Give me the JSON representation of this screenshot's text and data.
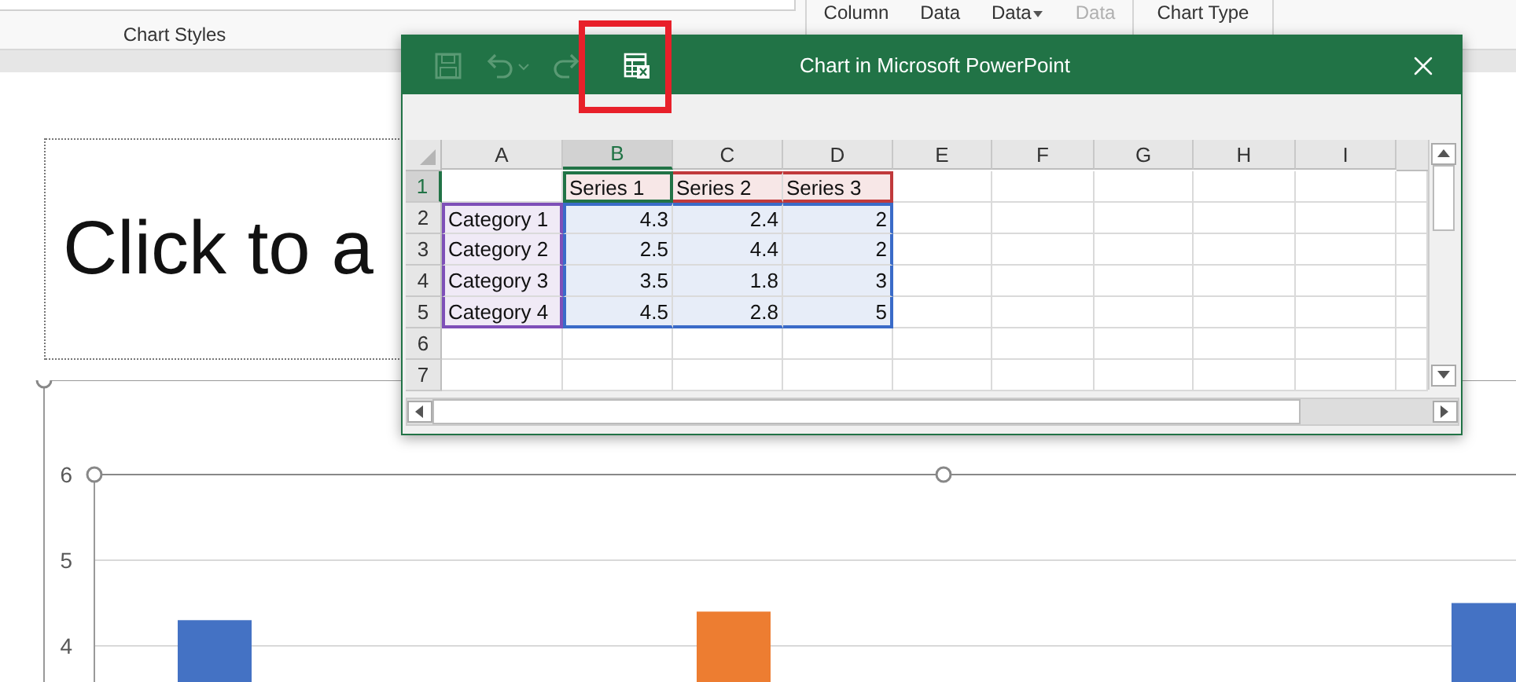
{
  "ribbon": {
    "groups": [
      {
        "label": "Chart Styles"
      }
    ],
    "buttons": [
      {
        "label": "Column",
        "disabled": false
      },
      {
        "label": "Data",
        "disabled": false
      },
      {
        "label": "Data",
        "disabled": false,
        "dropdown": true
      },
      {
        "label": "Data",
        "disabled": true
      },
      {
        "label": "Chart Type",
        "disabled": false
      }
    ]
  },
  "slide": {
    "title_placeholder": "Click to a"
  },
  "chart": {
    "axis_labels": [
      "6",
      "5",
      "4"
    ]
  },
  "dialog": {
    "title": "Chart in Microsoft PowerPoint",
    "columns": [
      {
        "label": "A",
        "selected": false
      },
      {
        "label": "B",
        "selected": true
      },
      {
        "label": "C",
        "selected": false
      },
      {
        "label": "D",
        "selected": false
      },
      {
        "label": "E",
        "selected": false
      },
      {
        "label": "F",
        "selected": false
      },
      {
        "label": "G",
        "selected": false
      },
      {
        "label": "H",
        "selected": false
      },
      {
        "label": "I",
        "selected": false
      }
    ],
    "rows": [
      {
        "label": "1",
        "selected": true,
        "cells": [
          {},
          {
            "text": "Series 1",
            "kind": "header",
            "selected": true
          },
          {
            "text": "Series 2",
            "kind": "header",
            "selected": false
          },
          {
            "text": "Series 3",
            "kind": "header",
            "selected": false
          },
          {},
          {},
          {},
          {},
          {}
        ]
      },
      {
        "label": "2",
        "selected": false,
        "cells": [
          {
            "text": "Category 1",
            "kind": "category"
          },
          {
            "text": "4.3",
            "kind": "value"
          },
          {
            "text": "2.4",
            "kind": "value"
          },
          {
            "text": "2",
            "kind": "value"
          },
          {},
          {},
          {},
          {},
          {}
        ]
      },
      {
        "label": "3",
        "selected": false,
        "cells": [
          {
            "text": "Category 2",
            "kind": "category"
          },
          {
            "text": "2.5",
            "kind": "value"
          },
          {
            "text": "4.4",
            "kind": "value"
          },
          {
            "text": "2",
            "kind": "value"
          },
          {},
          {},
          {},
          {},
          {}
        ]
      },
      {
        "label": "4",
        "selected": false,
        "cells": [
          {
            "text": "Category 3",
            "kind": "category"
          },
          {
            "text": "3.5",
            "kind": "value"
          },
          {
            "text": "1.8",
            "kind": "value"
          },
          {
            "text": "3",
            "kind": "value"
          },
          {},
          {},
          {},
          {},
          {}
        ]
      },
      {
        "label": "5",
        "selected": false,
        "cells": [
          {
            "text": "Category 4",
            "kind": "category"
          },
          {
            "text": "4.5",
            "kind": "value"
          },
          {
            "text": "2.8",
            "kind": "value"
          },
          {
            "text": "5",
            "kind": "value"
          },
          {},
          {},
          {},
          {},
          {}
        ]
      },
      {
        "label": "6",
        "selected": false,
        "cells": [
          {},
          {},
          {},
          {},
          {},
          {},
          {},
          {},
          {}
        ]
      },
      {
        "label": "7",
        "selected": false,
        "cells": [
          {},
          {},
          {},
          {},
          {},
          {},
          {},
          {},
          {}
        ]
      }
    ]
  }
}
